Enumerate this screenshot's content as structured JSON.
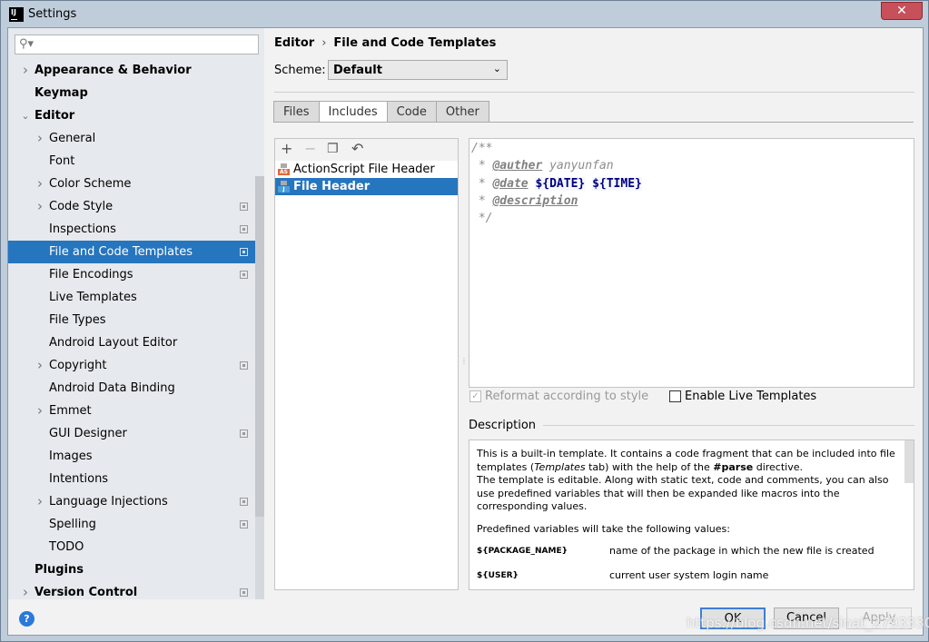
{
  "window": {
    "title": "Settings",
    "app_icon": "IJ",
    "close": "✕"
  },
  "search": {
    "placeholder": "",
    "icon": "search-icon"
  },
  "sidebar": {
    "items": [
      {
        "label": "Appearance & Behavior",
        "level": 0,
        "bold": true,
        "chevron": "right"
      },
      {
        "label": "Keymap",
        "level": 0,
        "bold": true
      },
      {
        "label": "Editor",
        "level": 0,
        "bold": true,
        "chevron": "down"
      },
      {
        "label": "General",
        "level": 1,
        "chevron": "right"
      },
      {
        "label": "Font",
        "level": 1
      },
      {
        "label": "Color Scheme",
        "level": 1,
        "chevron": "right"
      },
      {
        "label": "Code Style",
        "level": 1,
        "chevron": "right",
        "project": true
      },
      {
        "label": "Inspections",
        "level": 1,
        "project": true
      },
      {
        "label": "File and Code Templates",
        "level": 1,
        "project": true,
        "selected": true
      },
      {
        "label": "File Encodings",
        "level": 1,
        "project": true
      },
      {
        "label": "Live Templates",
        "level": 1
      },
      {
        "label": "File Types",
        "level": 1
      },
      {
        "label": "Android Layout Editor",
        "level": 1
      },
      {
        "label": "Copyright",
        "level": 1,
        "chevron": "right",
        "project": true
      },
      {
        "label": "Android Data Binding",
        "level": 1
      },
      {
        "label": "Emmet",
        "level": 1,
        "chevron": "right"
      },
      {
        "label": "GUI Designer",
        "level": 1,
        "project": true
      },
      {
        "label": "Images",
        "level": 1
      },
      {
        "label": "Intentions",
        "level": 1
      },
      {
        "label": "Language Injections",
        "level": 1,
        "chevron": "right",
        "project": true
      },
      {
        "label": "Spelling",
        "level": 1,
        "project": true
      },
      {
        "label": "TODO",
        "level": 1
      },
      {
        "label": "Plugins",
        "level": 0,
        "bold": true
      },
      {
        "label": "Version Control",
        "level": 0,
        "bold": true,
        "chevron": "right",
        "project": true
      }
    ]
  },
  "breadcrumb": {
    "parent": "Editor",
    "sep": "›",
    "current": "File and Code Templates"
  },
  "scheme": {
    "label": "Scheme:",
    "value": "Default"
  },
  "tabs": [
    {
      "label": "Files"
    },
    {
      "label": "Includes",
      "active": true
    },
    {
      "label": "Code"
    },
    {
      "label": "Other"
    }
  ],
  "list": {
    "toolbar": {
      "add": "+",
      "remove": "−",
      "copy": "❐",
      "reset": "↶"
    },
    "items": [
      {
        "label": "ActionScript File Header",
        "badge": "AS",
        "badge_color": "#e0683a"
      },
      {
        "label": "File Header",
        "badge": "J",
        "badge_color": "#4a9fd9",
        "selected": true
      }
    ]
  },
  "editor": {
    "l1": "/**",
    "l2_pre": " * ",
    "l2_tag": "@auther",
    "l2_text": " yanyunfan",
    "l3_pre": " * ",
    "l3_tag": "@date",
    "l3_sp": " ",
    "l3_v1": "${DATE}",
    "l3_sp2": " ",
    "l3_v2": "${TIME}",
    "l4_pre": " * ",
    "l4_tag": "@description",
    "l5": " */"
  },
  "options": {
    "reformat": {
      "label": "Reformat according to style",
      "checked": true,
      "disabled": true
    },
    "live_templates": {
      "label": "Enable Live Templates",
      "checked": false
    }
  },
  "description": {
    "heading": "Description",
    "p1a": "This is a built-in template. It contains a code fragment that can be included into file templates (",
    "p1b": "Templates",
    "p1c": " tab) with the help of the ",
    "p1d": "#parse",
    "p1e": " directive.",
    "p2": "The template is editable. Along with static text, code and comments, you can also use predefined variables that will then be expanded like macros into the corresponding values.",
    "p3": "Predefined variables will take the following values:",
    "vars": [
      {
        "name": "${PACKAGE_NAME}",
        "desc": "name of the package in which the new file is created"
      },
      {
        "name": "${USER}",
        "desc": "current user system login name"
      }
    ]
  },
  "buttons": {
    "help": "?",
    "ok": "OK",
    "cancel": "Cancel",
    "apply": "Apply"
  },
  "watermark": "https://blog.csdn.net/sinat_27933301"
}
